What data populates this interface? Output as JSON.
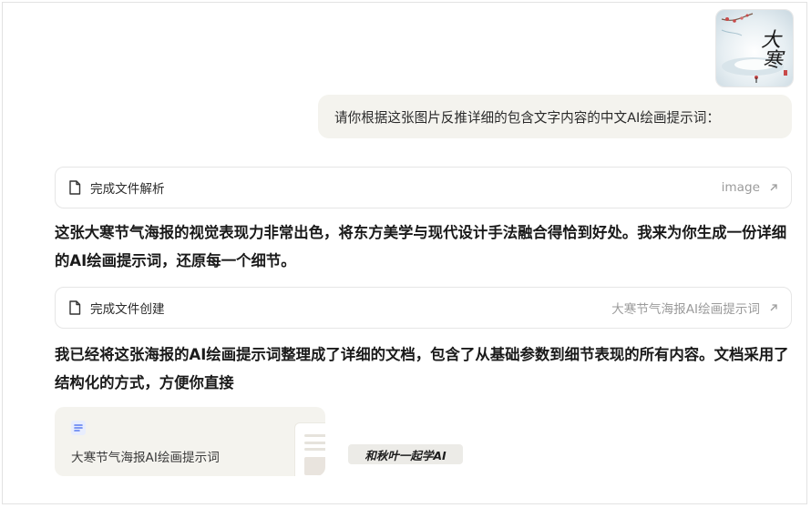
{
  "user_message": {
    "image_alt": "大寒节气海报缩略图",
    "text": "请你根据这张图片反推详细的包含文字内容的中文AI绘画提示词："
  },
  "thumbnail": {
    "calligraphy_top": "大",
    "calligraphy_bottom": "寒",
    "colors": {
      "bg": "#dfe9ee",
      "ink": "#1c1c1c",
      "plum": "#c84a4a"
    }
  },
  "cards": [
    {
      "icon": "document-icon",
      "label": "完成文件解析",
      "link_text": "image",
      "arrow": "external-arrow-icon"
    },
    {
      "icon": "document-icon",
      "label": "完成文件创建",
      "link_text": "大寒节气海报AI绘画提示词",
      "arrow": "external-arrow-icon"
    }
  ],
  "paragraphs": [
    "这张大寒节气海报的视觉表现力非常出色，将东方美学与现代设计手法融合得恰到好处。我来为你生成一份详细的AI绘画提示词，还原每一个细节。",
    "我已经将这张海报的AI绘画提示词整理成了详细的文档，包含了从基础参数到细节表现的所有内容。文档采用了结构化的方式，方便你直接"
  ],
  "file_tile": {
    "icon": "document-lines-icon",
    "name": "大寒节气海报AI绘画提示词"
  },
  "watermark": "和秋叶一起学AI",
  "colors": {
    "bubble_bg": "#f4f3ee",
    "card_border": "#e6e6e6",
    "muted_text": "#9b9b9b",
    "file_icon_blue": "#5a7cf0"
  }
}
